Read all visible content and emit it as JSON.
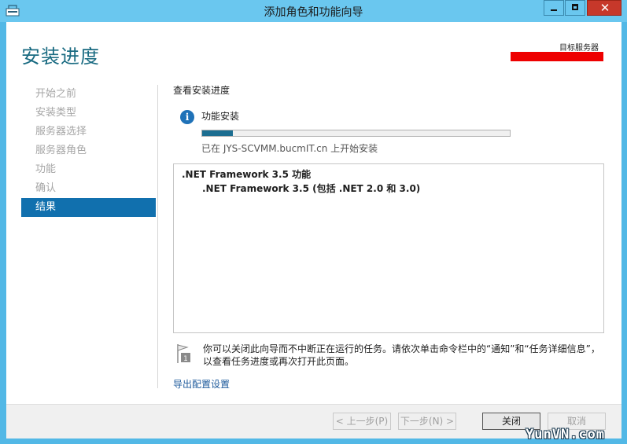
{
  "window": {
    "title": "添加角色和功能向导",
    "close_glyph": "✕"
  },
  "header": {
    "page_title": "安装进度",
    "target_label": "目标服务器"
  },
  "nav": {
    "items": [
      {
        "label": "开始之前",
        "active": false
      },
      {
        "label": "安装类型",
        "active": false
      },
      {
        "label": "服务器选择",
        "active": false
      },
      {
        "label": "服务器角色",
        "active": false
      },
      {
        "label": "功能",
        "active": false
      },
      {
        "label": "确认",
        "active": false
      },
      {
        "label": "结果",
        "active": true
      }
    ]
  },
  "main": {
    "section_title": "查看安装进度",
    "status": {
      "icon_glyph": "i",
      "title": "功能安装",
      "progress_fraction": 0.1,
      "caption": "已在 JYS-SCVMM.bucmIT.cn 上开始安装"
    },
    "results": [
      ".NET Framework 3.5 功能",
      ".NET Framework 3.5 (包括 .NET 2.0 和 3.0)"
    ],
    "note": "你可以关闭此向导而不中断正在运行的任务。请依次单击命令栏中的“通知”和“任务详细信息”，以查看任务进度或再次打开此页面。",
    "note_icon_badge": "1",
    "export_link": "导出配置设置"
  },
  "footer": {
    "prev_label": "< 上一步(P)",
    "next_label": "下一步(N) >",
    "close_label": "关闭",
    "cancel_label": "取消"
  },
  "watermark": "YunVN.com",
  "colors": {
    "title_bar": "#6ac7ef",
    "accent": "#1170ae",
    "progress": "#1c6e91",
    "redaction": "#ee0000"
  }
}
